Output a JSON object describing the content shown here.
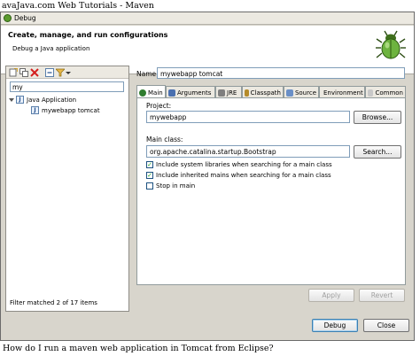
{
  "tutorial_title": "avaJava.com Web Tutorials - Maven",
  "window": {
    "title": "Debug"
  },
  "banner": {
    "heading": "Create, manage, and run configurations",
    "subtitle": "Debug a Java application"
  },
  "left_pane": {
    "filter_value": "my",
    "tree": [
      {
        "label": "Java Application",
        "level": 0
      },
      {
        "label": "mywebapp tomcat",
        "level": 1
      }
    ],
    "status": "Filter matched 2 of 17 items"
  },
  "config": {
    "name_label": "Name:",
    "name_value": "mywebapp tomcat",
    "tabs": [
      "Main",
      "Arguments",
      "JRE",
      "Classpath",
      "Source",
      "Environment",
      "Common"
    ],
    "project_label": "Project:",
    "project_value": "mywebapp",
    "browse_label": "Browse...",
    "main_class_label": "Main class:",
    "main_class_value": "org.apache.catalina.startup.Bootstrap",
    "search_label": "Search...",
    "checkboxes": [
      {
        "label": "Include system libraries when searching for a main class",
        "checked": true
      },
      {
        "label": "Include inherited mains when searching for a main class",
        "checked": true
      },
      {
        "label": "Stop in main",
        "checked": false
      }
    ],
    "apply_label": "Apply",
    "revert_label": "Revert"
  },
  "footer": {
    "debug_label": "Debug",
    "close_label": "Close"
  },
  "caption": "How do I run a maven web application in Tomcat from Eclipse?"
}
